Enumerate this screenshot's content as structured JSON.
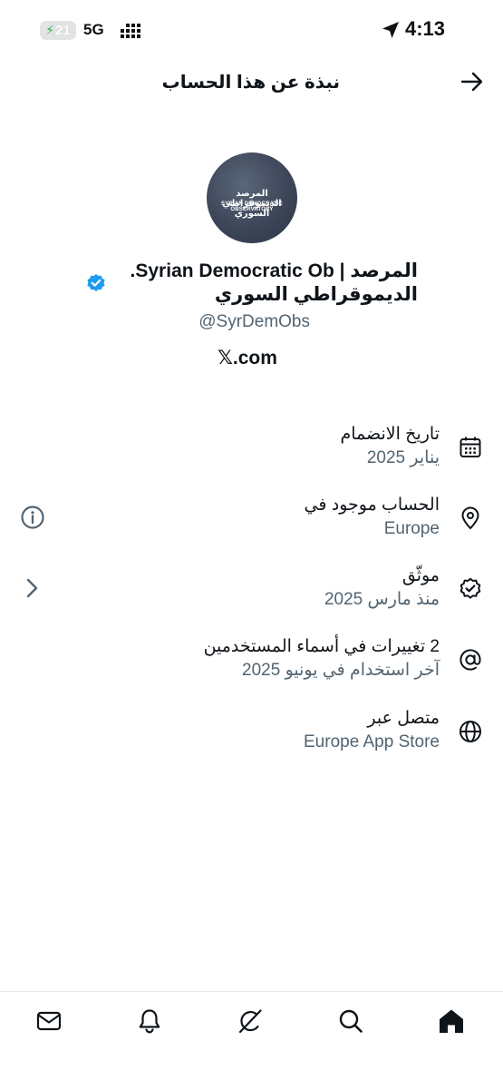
{
  "status_bar": {
    "time": "4:13",
    "network": "5G",
    "battery_level": "21"
  },
  "header": {
    "title": "نبذة عن هذا الحساب"
  },
  "profile": {
    "avatar_text_ar": "المرصد الديموقراطي السوري",
    "avatar_text_en": "SYRIAN DEMOCRATIC OBSERVATORY",
    "display_name": "المرصد | Syrian Democratic Ob. الديموقراطي السوري",
    "handle": "@SyrDemObs",
    "link_glyph": "𝕏",
    "link_text": ".com"
  },
  "info_rows": [
    {
      "title": "تاريخ الانضمام",
      "subtitle": "يناير 2025",
      "icon": "calendar-icon"
    },
    {
      "title": "الحساب موجود في",
      "subtitle": "Europe",
      "icon": "location-pin-icon",
      "action_icon": "info-icon"
    },
    {
      "title": "موثّق",
      "subtitle": "منذ مارس 2025",
      "icon": "verified-check-icon",
      "action_icon": "chevron-right-icon"
    },
    {
      "title": "2 تغييرات في أسماء المستخدمين",
      "subtitle": "آخر استخدام في يونيو 2025",
      "icon": "at-sign-icon"
    },
    {
      "title": "متصل عبر",
      "subtitle": "Europe App Store",
      "icon": "globe-icon"
    }
  ],
  "bottom_nav": [
    "messages-icon",
    "notifications-icon",
    "grok-icon",
    "search-icon",
    "home-icon"
  ],
  "colors": {
    "text": "#0f1419",
    "secondary_text": "#536471",
    "verified_blue": "#1d9bf0",
    "divider": "#e7e9ea"
  }
}
